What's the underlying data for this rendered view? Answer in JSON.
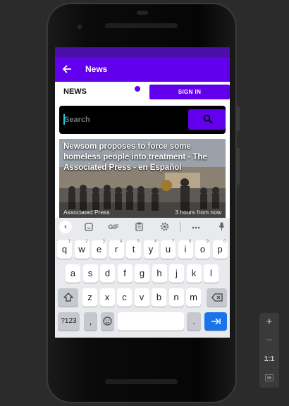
{
  "app": {
    "title": "News",
    "back_icon": "arrow-left-icon",
    "accent_color": "#6200ee",
    "status_bar_color": "#4a0fa8"
  },
  "header": {
    "section_label": "NEWS",
    "signin_label": "SIGN IN"
  },
  "search": {
    "placeholder": "Search",
    "value": "",
    "icon": "search-icon"
  },
  "articles": [
    {
      "headline": "Newsom proposes to force some homeless people into treatment - The Associated Press - en Español",
      "source": "Associated Press",
      "time": "3 hours from now"
    }
  ],
  "keyboard": {
    "toolbar": {
      "collapse_icon": "chevron-left-icon",
      "sticker_icon": "sticker-icon",
      "gif_label": "GIF",
      "clipboard_icon": "clipboard-icon",
      "settings_icon": "gear-icon",
      "more_icon": "more-icon",
      "mic_icon": "mic-icon"
    },
    "row1": [
      {
        "k": "q",
        "h": "1"
      },
      {
        "k": "w",
        "h": "2"
      },
      {
        "k": "e",
        "h": "3"
      },
      {
        "k": "r",
        "h": "4"
      },
      {
        "k": "t",
        "h": "5"
      },
      {
        "k": "y",
        "h": "6"
      },
      {
        "k": "u",
        "h": "7"
      },
      {
        "k": "i",
        "h": "8"
      },
      {
        "k": "o",
        "h": "9"
      },
      {
        "k": "p",
        "h": "0"
      }
    ],
    "row2": [
      "a",
      "s",
      "d",
      "f",
      "g",
      "h",
      "j",
      "k",
      "l"
    ],
    "row3": [
      "z",
      "x",
      "c",
      "v",
      "b",
      "n",
      "m"
    ],
    "shift_icon": "shift-icon",
    "backspace_icon": "backspace-icon",
    "numbers_label": "?123",
    "comma_label": ",",
    "emoji_icon": "emoji-icon",
    "period_label": ".",
    "enter_icon": "enter-arrow-icon"
  },
  "emulator_panel": {
    "zoom_in": "+",
    "zoom_out": "−",
    "actual_size": "1:1",
    "fit_icon": "fit-screen-icon"
  }
}
